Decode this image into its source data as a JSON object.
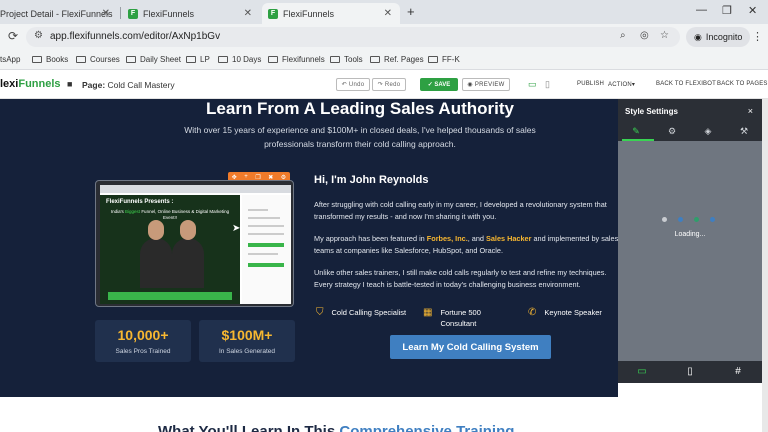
{
  "browser": {
    "tabs": [
      {
        "title": "Project Detail - FlexiFunnels",
        "active": false
      },
      {
        "title": "FlexiFunnels",
        "active": false
      },
      {
        "title": "FlexiFunnels",
        "active": true
      }
    ],
    "new_tab": "+",
    "window_controls": [
      "—",
      "❐",
      "✕"
    ],
    "url": "app.flexifunnels.com/editor/AxNp1bGv",
    "incognito_label": "Incognito",
    "bookmarks": [
      "tsApp",
      "Books",
      "Courses",
      "Daily Sheet",
      "LP",
      "10 Days",
      "Flexifunnels",
      "Tools",
      "Ref. Pages",
      "FF-K"
    ]
  },
  "editor": {
    "logo_prefix": "lexi",
    "logo_suffix": "Funnels",
    "page_label": "Page:",
    "page_name": "Cold Call Mastery",
    "undo": "Undo",
    "redo": "Redo",
    "save": "SAVE",
    "preview": "PREVIEW",
    "publish": "PUBLISH",
    "action": "ACTION",
    "back_flexibot": "BACK TO FLEXIBOT",
    "back_pages": "BACK TO PAGES"
  },
  "hero": {
    "title": "Learn From A Leading Sales Authority",
    "subtitle": "With over 15 years of experience and $100M+ in closed deals, I've helped thousands of sales professionals transform their cold calling approach."
  },
  "video": {
    "brand": "FlexiFunnels Presents :",
    "headline_pre": "India's",
    "headline_hl": "Biggest",
    "headline_post": "Funnel, Online Business & Digital Marketing Event!!"
  },
  "stats": [
    {
      "number": "10,000+",
      "label": "Sales Pros Trained"
    },
    {
      "number": "$100M+",
      "label": "In Sales Generated"
    }
  ],
  "bio": {
    "greeting": "Hi, I'm John Reynolds",
    "p1": "After struggling with cold calling early in my career, I developed a revolutionary system that transformed my results - and now I'm sharing it with you.",
    "p2_a": "My approach has been featured in ",
    "p2_forbes": "Forbes, Inc.",
    "p2_b": ", and ",
    "p2_hacker": "Sales Hacker",
    "p2_c": " and implemented by sales teams at companies like Salesforce, HubSpot, and Oracle.",
    "p3": "Unlike other sales trainers, I still make cold calls regularly to test and refine my techniques. Every strategy I teach is battle-tested in today's challenging business environment."
  },
  "badges": [
    {
      "icon": "shield-check-icon",
      "label": "Cold Calling Specialist"
    },
    {
      "icon": "building-icon",
      "label": "Fortune 500 Consultant"
    },
    {
      "icon": "megaphone-icon",
      "label": "Keynote Speaker"
    }
  ],
  "cta": "Learn My Cold Calling System",
  "next_section": {
    "title_a": "What You'll Learn In This ",
    "title_b": "Comprehensive Training"
  },
  "panel": {
    "title": "Style Settings",
    "close": "×",
    "loading": "Loading..."
  },
  "colors": {
    "accent_green": "#2ea043",
    "hero_bg": "#15213a",
    "highlight_yellow": "#f7b731",
    "cta_blue": "#3f7fc1"
  }
}
